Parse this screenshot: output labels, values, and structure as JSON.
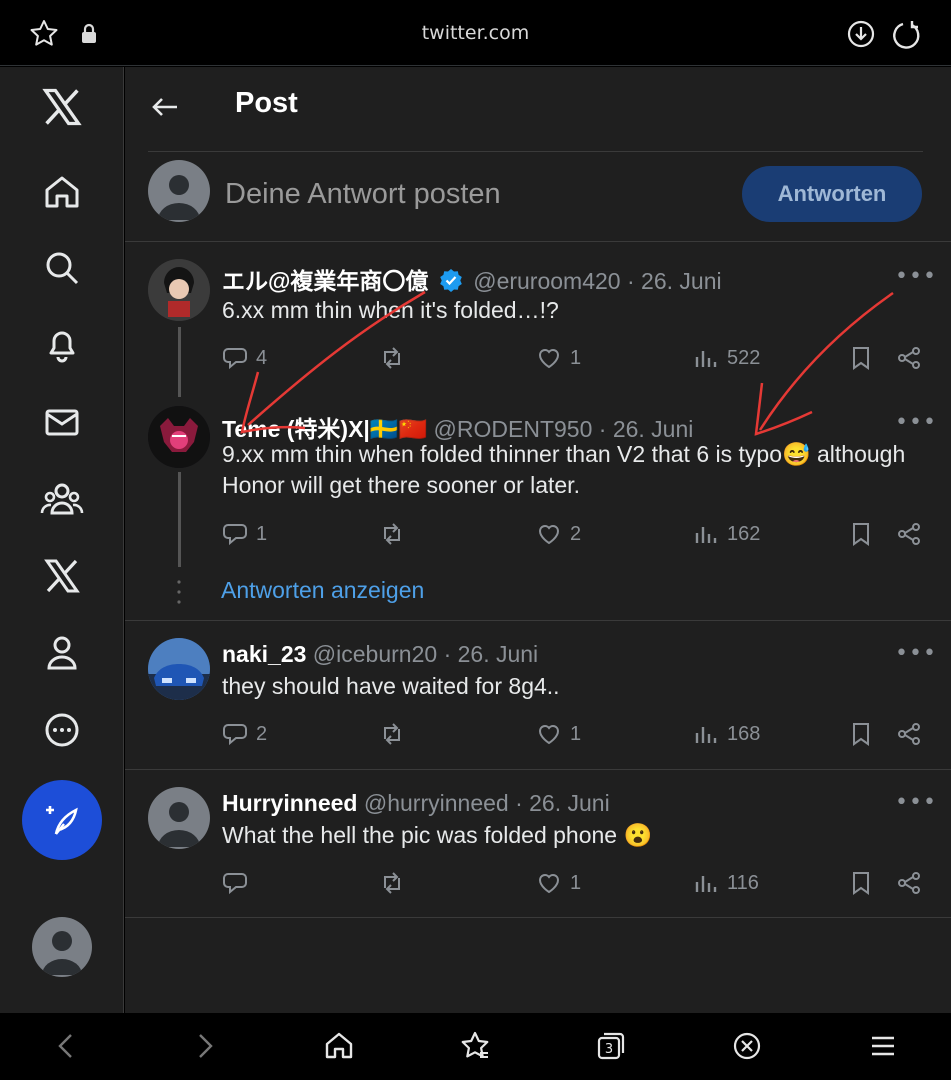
{
  "browser": {
    "url": "twitter.com",
    "tab_count": "3"
  },
  "page": {
    "title": "Post"
  },
  "composer": {
    "placeholder": "Deine Antwort posten",
    "button_label": "Antworten"
  },
  "tweets": [
    {
      "name": "エル@複業年商〇億",
      "verified": true,
      "handle": "@eruroom420",
      "date": "· 26. Juni",
      "text": "6.xx mm thin when it's folded…!?",
      "replies": "4",
      "retweets": "",
      "likes": "1",
      "views": "522"
    },
    {
      "name": "Teme (特米)X|🇸🇪🇨🇳",
      "handle": "@RODENT950",
      "date": "· 26. Juni",
      "text": "9.xx mm thin when folded thinner than V2 that 6 is typo😅 although Honor will get there sooner or later.",
      "replies": "1",
      "retweets": "",
      "likes": "2",
      "views": "162"
    },
    {
      "name": "naki_23",
      "handle": "@iceburn20",
      "date": "· 26. Juni",
      "text": "they should have waited for 8g4..",
      "replies": "2",
      "retweets": "",
      "likes": "1",
      "views": "168"
    },
    {
      "name": "Hurryinneed",
      "handle": "@hurryinneed",
      "date": "· 26. Juni",
      "text": "What the hell the pic was folded phone 😮",
      "replies": "",
      "retweets": "",
      "likes": "1",
      "views": "116"
    }
  ],
  "thread": {
    "show_replies": "Antworten anzeigen"
  },
  "colors": {
    "accent": "#1d9bf0",
    "fab": "#1d4ed8",
    "annotation": "#e53935"
  }
}
